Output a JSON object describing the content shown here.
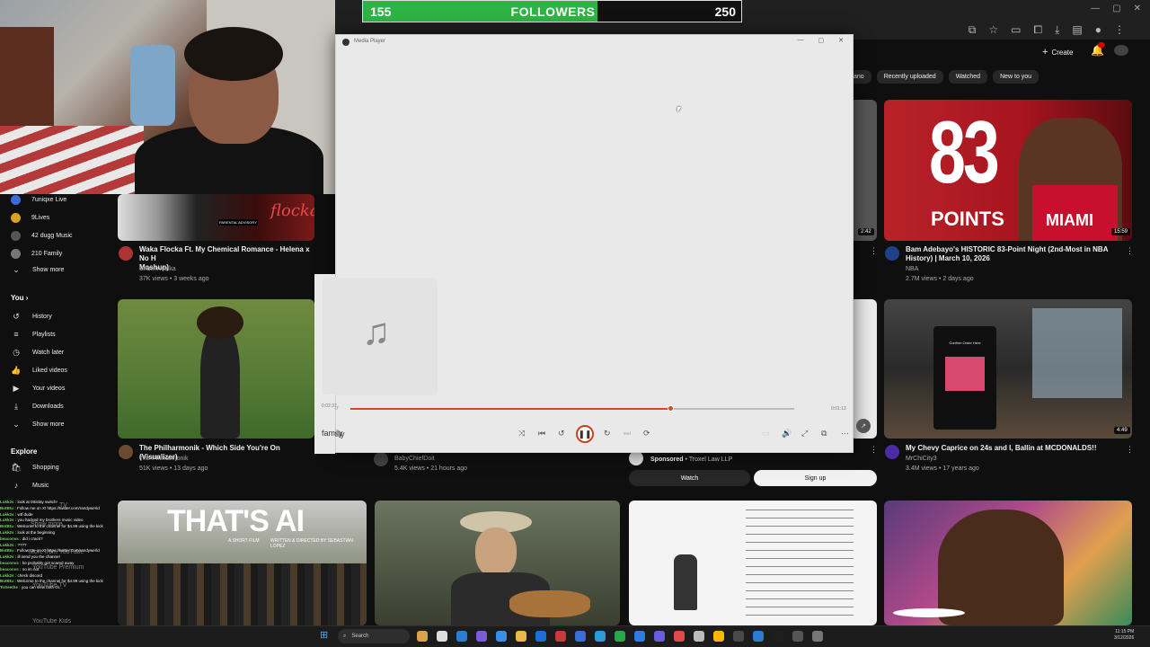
{
  "followers": {
    "current": "155",
    "label": "FOLLOWERS",
    "goal": "250",
    "progress": 0.62
  },
  "header": {
    "create_label": "Create",
    "notif_count": "9+"
  },
  "chips": [
    "ano",
    "Recently uploaded",
    "Watched",
    "New to you"
  ],
  "sidebar": {
    "subs": [
      {
        "label": "7uniqxe Live",
        "color": "#3a6bd6"
      },
      {
        "label": "9Lives",
        "color": "#d9a21c"
      },
      {
        "label": "42 dugg Music",
        "color": "#555"
      },
      {
        "label": "210 Family",
        "color": "#777"
      }
    ],
    "show_more": "Show more",
    "you_heading": "You",
    "you_items": [
      {
        "label": "History",
        "icon": "history-icon",
        "glyph": "↺"
      },
      {
        "label": "Playlists",
        "icon": "playlists-icon",
        "glyph": "≡"
      },
      {
        "label": "Watch later",
        "icon": "clock-icon",
        "glyph": "◷"
      },
      {
        "label": "Liked videos",
        "icon": "thumbs-up-icon",
        "glyph": "👍"
      },
      {
        "label": "Your videos",
        "icon": "video-icon",
        "glyph": "▶"
      },
      {
        "label": "Downloads",
        "icon": "download-icon",
        "glyph": "⤓"
      }
    ],
    "show_more_2": "Show more",
    "explore_heading": "Explore",
    "explore_items": [
      {
        "label": "Shopping",
        "icon": "shopping-icon",
        "glyph": "🛍"
      },
      {
        "label": "Music",
        "icon": "music-icon",
        "glyph": "♪"
      }
    ],
    "partial_items": [
      "TV",
      "Show more",
      "More from YouTube",
      "YouTube Premium",
      "YouTube TV",
      "YouTube Kids"
    ]
  },
  "chat": [
    {
      "user": "Lukk2s :",
      "msg": "look at 0Sistay switch!"
    },
    {
      "user": "BotBtu :",
      "msg": "Follow me on X! https://twitter.com/randywerld"
    },
    {
      "user": "Lukk2s :",
      "msg": "wtf dude"
    },
    {
      "user": "Lukk2s :",
      "msg": "you hacked my brothers music video"
    },
    {
      "user": "BotBtu :",
      "msg": "Welcome to the channel for $4.99 using the kick"
    },
    {
      "user": "Lukk2s :",
      "msg": "look at the beginning"
    },
    {
      "user": "beaconvs :",
      "msg": "did i crack?"
    },
    {
      "user": "Lukk2s :",
      "msg": "????"
    },
    {
      "user": "BotBtu :",
      "msg": "Follow me on X! https://twitter.com/randywerld"
    },
    {
      "user": "Lukk2s :",
      "msg": "ill send you the channel"
    },
    {
      "user": "beaconvs :",
      "msg": "he probably got scared away"
    },
    {
      "user": "beaconvs :",
      "msg": "no im not"
    },
    {
      "user": "Lukk2s :",
      "msg": "check discord"
    },
    {
      "user": "BotBtu :",
      "msg": "Welcome to the channel for $4.99 using the kick"
    },
    {
      "user": "ToSeethe :",
      "msg": "you can view both ch..."
    }
  ],
  "videos": {
    "waka": {
      "title_1": "Waka Flocka Ft. My Chemical Romance - Helena x No H",
      "title_2": "Mashup)",
      "channel": "ShawnWalka",
      "meta": "37K views • 3 weeks ago"
    },
    "bam": {
      "title_1": "Bam Adebayo's HISTORIC 83-Point Night (2nd-Most in NBA",
      "title_2": "History) | March 10, 2026",
      "channel": "NBA",
      "meta": "2.7M views • 2 days ago",
      "duration": "15:59",
      "thumb_num": "83",
      "thumb_word": "POINTS",
      "jersey": "MIAMI"
    },
    "side_dur": "2:42",
    "phil": {
      "title": "The Philharmonik - Which Side You're On (Visualizer)",
      "channel": "The Philharmonik",
      "meta": "51K views • 13 days ago"
    },
    "baby": {
      "channel": "BabyChiefDoit",
      "meta": "5.4K views • 21 hours ago"
    },
    "ad": {
      "label": "Sponsored",
      "advertiser": "Troxel Law LLP",
      "watch": "Watch",
      "signup": "Sign up"
    },
    "chevy": {
      "title": "My Chevy Caprice on 24s and I, Ballin at MCDONALDS!!",
      "channel": "MrChiCity3",
      "meta": "3.4M views • 17 years ago",
      "duration": "4:49",
      "sign": "Confirm Order Here"
    },
    "thats_ai": {
      "headline": "THAT'S AI",
      "sub": "A SHORT FILM",
      "credit": "WRITTEN & DIRECTED BY SEBASTIAN LOPEZ"
    },
    "waka_art": {
      "logo": "flocka",
      "advisory": "PARENTAL ADVISORY"
    }
  },
  "player": {
    "window_title": "Media Player",
    "elapsed": "0:02:37",
    "remaining": "0:01:13",
    "progress": 0.72,
    "song": "family"
  },
  "taskbar": {
    "search": "Search",
    "time": "11:15 PM",
    "date": "3/12/2026"
  }
}
